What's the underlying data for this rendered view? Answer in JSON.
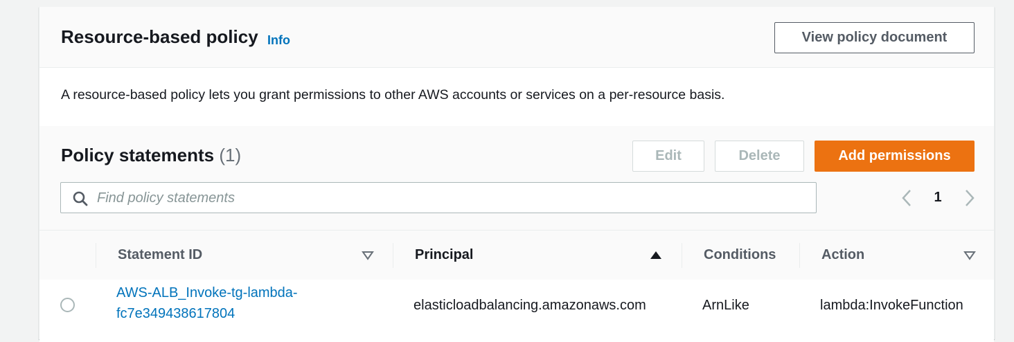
{
  "panel": {
    "title": "Resource-based policy",
    "info_label": "Info",
    "view_button": "View policy document",
    "description": "A resource-based policy lets you grant permissions to other AWS accounts or services on a per-resource basis."
  },
  "statements": {
    "title": "Policy statements",
    "count": "(1)",
    "edit_label": "Edit",
    "delete_label": "Delete",
    "add_label": "Add permissions",
    "search_placeholder": "Find policy statements",
    "search_value": "",
    "page_number": "1"
  },
  "table": {
    "columns": [
      "Statement ID",
      "Principal",
      "Conditions",
      "Action"
    ],
    "rows": [
      {
        "statement_id_line1": "AWS-ALB_Invoke-tg-lambda-",
        "statement_id_line2": "fc7e349438617804",
        "principal": "elasticloadbalancing.amazonaws.com",
        "conditions": "ArnLike",
        "action": "lambda:InvokeFunction"
      }
    ]
  },
  "colors": {
    "primary_button": "#ec7211",
    "link": "#0073bb",
    "text": "#16191f"
  },
  "icons": [
    "search-icon",
    "chevron-left-icon",
    "chevron-right-icon",
    "sort-down-icon",
    "sort-up-icon"
  ]
}
